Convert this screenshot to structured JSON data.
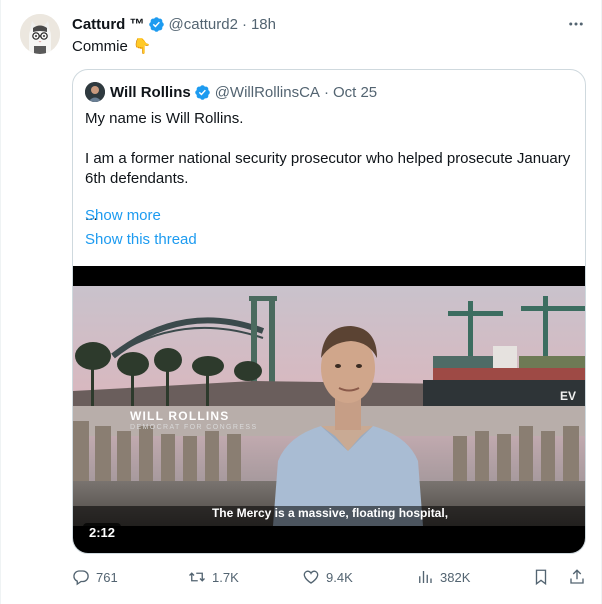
{
  "author": {
    "name": "Catturd ™",
    "handle": "@catturd2",
    "separator": "·",
    "time": "18h",
    "verified": true,
    "avatar_icon": "cat-avatar"
  },
  "more_icon": "more-dots-icon",
  "tweet": {
    "text": "Commie",
    "emoji": "👇"
  },
  "quote": {
    "author_name": "Will Rollins",
    "author_handle": "@WillRollinsCA",
    "separator": "·",
    "date": "Oct 25",
    "verified": true,
    "paragraph1": "My name is Will Rollins.",
    "paragraph2": "I am a former national security prosecutor who helped prosecute January 6th defendants.",
    "ellipsis": "...",
    "show_more": "Show more",
    "show_thread": "Show this thread",
    "video": {
      "duration": "2:12",
      "subtitle": "The Mercy is a massive, floating hospital,",
      "lower_third_name": "WILL ROLLINS",
      "lower_third_title": "DEMOCRAT FOR CONGRESS",
      "background_text": "EV"
    }
  },
  "actions": {
    "replies": "761",
    "reposts": "1.7K",
    "likes": "9.4K",
    "views": "382K"
  },
  "colors": {
    "link": "#1d9bf0",
    "verified": "#1d9bf0",
    "secondary_text": "#536471",
    "border": "#cfd9de"
  }
}
